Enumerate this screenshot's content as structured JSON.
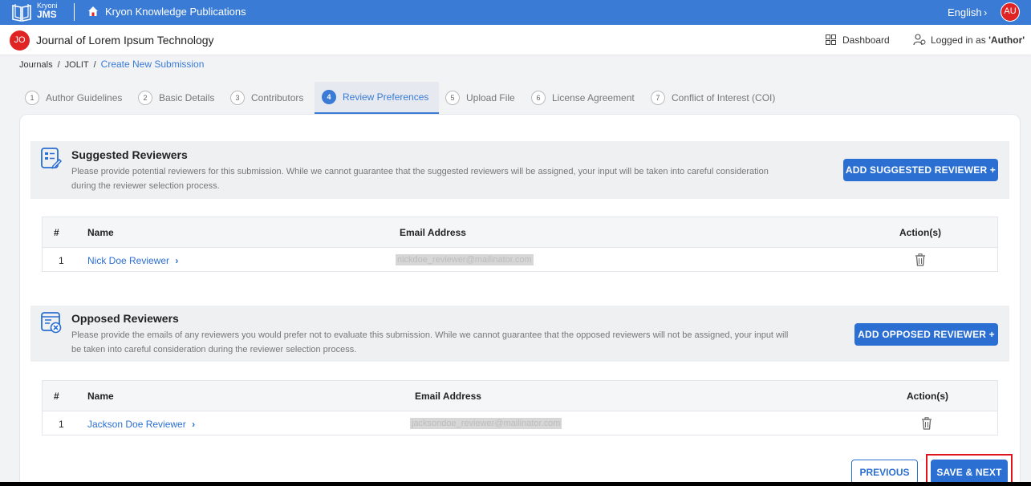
{
  "app": {
    "logo_line1": "Kryoni",
    "logo_line2": "JMS",
    "publisher": "Kryon Knowledge Publications",
    "language": "English",
    "user_initials": "AU"
  },
  "journal": {
    "initials": "JO",
    "title": "Journal of Lorem Ipsum Technology",
    "dashboard_label": "Dashboard",
    "logged_in_prefix": "Logged in as ",
    "logged_in_role": "'Author'"
  },
  "breadcrumb": {
    "items": [
      "Journals",
      "JOLIT"
    ],
    "current": "Create New Submission"
  },
  "steps": [
    {
      "num": "1",
      "label": "Author Guidelines"
    },
    {
      "num": "2",
      "label": "Basic Details"
    },
    {
      "num": "3",
      "label": "Contributors"
    },
    {
      "num": "4",
      "label": "Review Preferences"
    },
    {
      "num": "5",
      "label": "Upload File"
    },
    {
      "num": "6",
      "label": "License Agreement"
    },
    {
      "num": "7",
      "label": "Conflict of Interest (COI)"
    }
  ],
  "suggested": {
    "title": "Suggested Reviewers",
    "description": "Please provide potential reviewers for this submission. While we cannot guarantee that the suggested reviewers will be assigned, your input will be taken into careful consideration during the reviewer selection process.",
    "add_button": "ADD SUGGESTED REVIEWER +",
    "columns": [
      "#",
      "Name",
      "Email Address",
      "Action(s)"
    ],
    "rows": [
      {
        "index": "1",
        "name": "Nick Doe Reviewer",
        "email": "nickdoe_reviewer@mailinator.com"
      }
    ]
  },
  "opposed": {
    "title": "Opposed Reviewers",
    "description": "Please provide the emails of any reviewers you would prefer not to evaluate this submission. While we cannot guarantee that the opposed reviewers will not be assigned, your input will be taken into careful consideration during the reviewer selection process.",
    "add_button": "ADD OPPOSED REVIEWER +",
    "columns": [
      "#",
      "Name",
      "Email Address",
      "Action(s)"
    ],
    "rows": [
      {
        "index": "1",
        "name": "Jackson Doe Reviewer",
        "email": "jacksondoe_reviewer@mailinator.com"
      }
    ]
  },
  "footer": {
    "previous": "PREVIOUS",
    "save_next": "SAVE & NEXT"
  },
  "colors": {
    "topbar": "#3a7bd5",
    "primary": "#2a6fd1",
    "badge": "#e02424",
    "highlight": "#e0141c"
  },
  "icons": {
    "home": "home-icon",
    "dashboard": "grid-icon",
    "user": "user-icon",
    "suggested": "clipboard-edit-icon",
    "opposed": "list-remove-icon",
    "delete": "trash-icon"
  }
}
